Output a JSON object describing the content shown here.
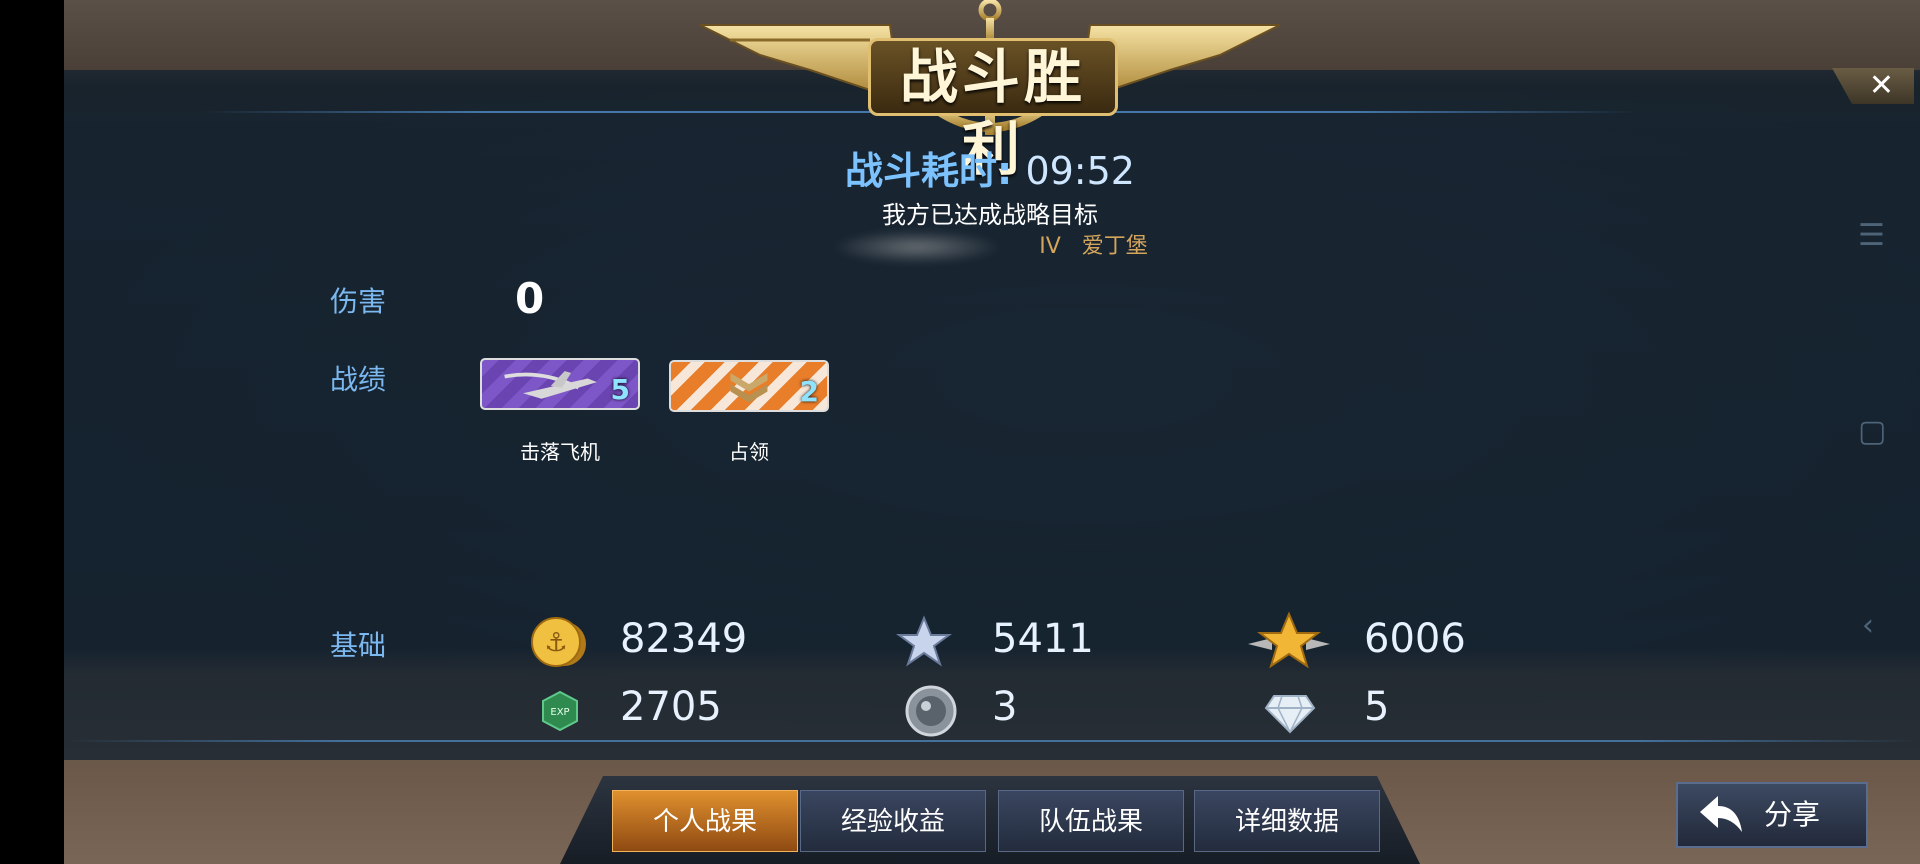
{
  "banner": {
    "title": "战斗胜利"
  },
  "close": {
    "label": "✕"
  },
  "battle": {
    "time_label": "战斗耗时:",
    "time_value": "09:52",
    "result": "我方已达成战略目标",
    "ship_tier": "IV",
    "ship_name": "爱丁堡"
  },
  "sections": {
    "damage": "伤害",
    "record": "战绩",
    "base": "基础"
  },
  "damage_value": "0",
  "achievements": [
    {
      "label": "击落飞机",
      "count": "5",
      "icon": "plane-icon",
      "color": "#7d56c8"
    },
    {
      "label": "占领",
      "count": "2",
      "icon": "chevron-rank-icon",
      "color": "#e87d2a"
    }
  ],
  "resources": {
    "silver": {
      "value": "82349",
      "icon": "gold-coin-icon"
    },
    "star_silver": {
      "value": "5411",
      "icon": "silver-star-icon"
    },
    "star_gold": {
      "value": "6006",
      "icon": "gold-winged-star-icon"
    },
    "exp": {
      "value": "2705",
      "icon": "exp-icon"
    },
    "medal": {
      "value": "3",
      "icon": "steel-medal-icon"
    },
    "diamond": {
      "value": "5",
      "icon": "diamond-icon"
    }
  },
  "tabs": [
    {
      "label": "个人战果",
      "active": true
    },
    {
      "label": "经验收益",
      "active": false
    },
    {
      "label": "队伍战果",
      "active": false
    },
    {
      "label": "详细数据",
      "active": false
    }
  ],
  "share": {
    "label": "分享"
  },
  "colors": {
    "accent_blue": "#7cb8f0",
    "tab_active": "#e0902e",
    "ship_gold": "#d4a45a"
  }
}
